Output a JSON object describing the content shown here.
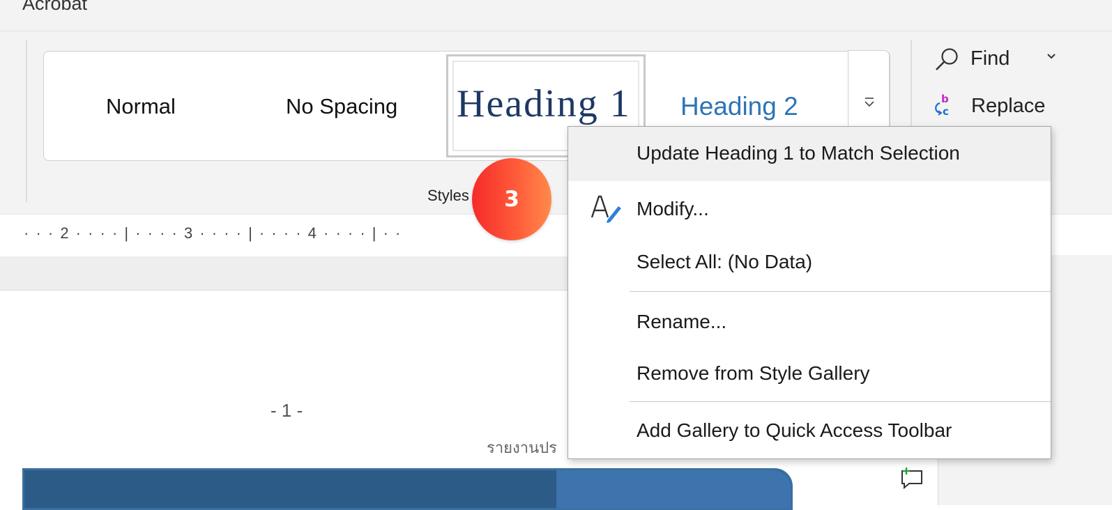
{
  "app": {
    "tab_label": "Acrobat"
  },
  "ribbon": {
    "styles": [
      {
        "label": "Normal"
      },
      {
        "label": "No Spacing"
      },
      {
        "label": "Heading 1"
      },
      {
        "label": "Heading 2"
      }
    ],
    "styles_group_label": "Styles",
    "editing": {
      "find_label": "Find",
      "replace_label": "Replace"
    }
  },
  "ruler": {
    "text": "· · · 2 · · · · | · · · · 3 · · · · | · · · · 4 · · · · | · ·"
  },
  "document": {
    "page_number": "- 1 -",
    "footer_text": "รายงานปร"
  },
  "callout": {
    "number": "3"
  },
  "context_menu": {
    "items": [
      {
        "label": "Update Heading 1 to Match Selection",
        "icon": ""
      },
      {
        "label": "Modify...",
        "icon": "modify-style-icon"
      },
      {
        "label": "Select All: (No Data)",
        "icon": ""
      },
      {
        "label": "Rename...",
        "icon": ""
      },
      {
        "label": "Remove from Style Gallery",
        "icon": ""
      },
      {
        "label": "Add Gallery to Quick Access Toolbar",
        "icon": ""
      }
    ]
  },
  "colors": {
    "heading1": "#1f3864",
    "heading2": "#2e74b5",
    "badge_start": "#f52a2a",
    "badge_end": "#ff8a4a"
  }
}
